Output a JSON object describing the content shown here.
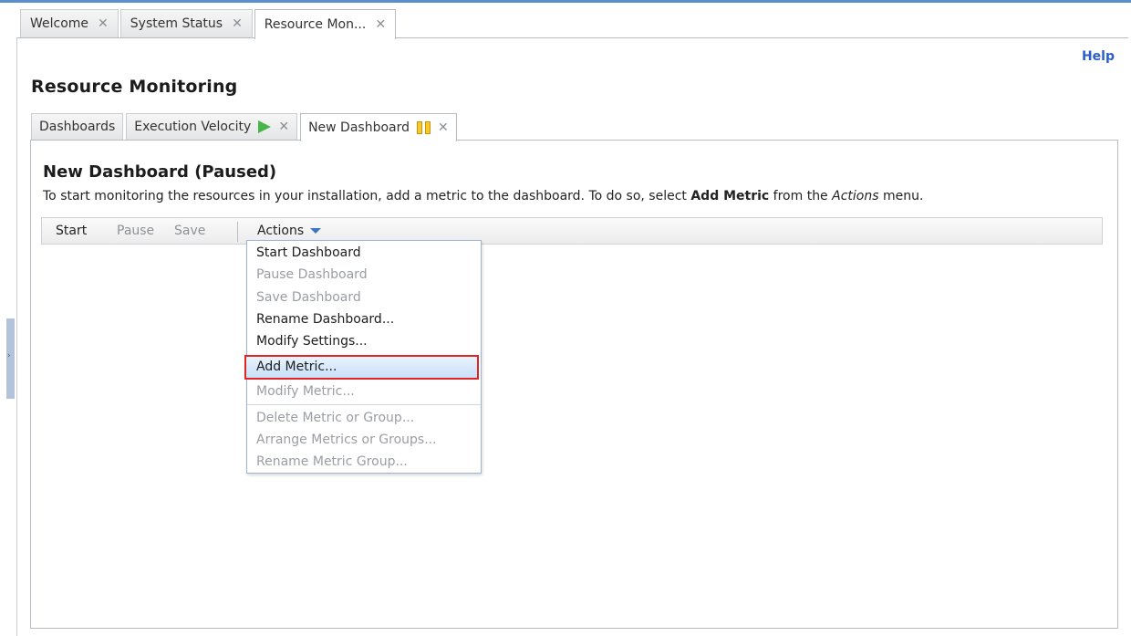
{
  "outer_tabs": [
    {
      "label": "Welcome",
      "active": false
    },
    {
      "label": "System Status",
      "active": false
    },
    {
      "label": "Resource Mon...",
      "active": true
    }
  ],
  "help": "Help",
  "page_title": "Resource Monitoring",
  "inner_tabs": [
    {
      "label": "Dashboards",
      "icon": null,
      "closable": false
    },
    {
      "label": "Execution Velocity",
      "icon": "play-icon",
      "closable": true
    },
    {
      "label": "New Dashboard",
      "icon": "pause-icon",
      "closable": true,
      "active": true
    }
  ],
  "dashboard": {
    "title": "New Dashboard (Paused)",
    "instruction_prefix": "To start monitoring the resources in your installation, add a metric to the dashboard.  To do so, select ",
    "instruction_bold": "Add Metric",
    "instruction_middle": " from the ",
    "instruction_italic": "Actions",
    "instruction_suffix": " menu."
  },
  "toolbar": {
    "start": "Start",
    "pause": "Pause",
    "save": "Save",
    "actions": "Actions"
  },
  "actions_menu": [
    {
      "label": "Start Dashboard",
      "enabled": true
    },
    {
      "label": "Pause Dashboard",
      "enabled": false
    },
    {
      "label": "Save Dashboard",
      "enabled": false
    },
    {
      "label": "Rename Dashboard...",
      "enabled": true
    },
    {
      "label": "Modify Settings...",
      "enabled": true
    },
    {
      "label": "Add Metric...",
      "enabled": true,
      "highlighted": true
    },
    {
      "label": "Modify Metric...",
      "enabled": false
    },
    {
      "label": "Delete Metric or Group...",
      "enabled": false
    },
    {
      "label": "Arrange Metrics or Groups...",
      "enabled": false
    },
    {
      "label": "Rename Metric Group...",
      "enabled": false
    }
  ],
  "colors": {
    "accent": "#5b8fc9",
    "link": "#2a5fc9",
    "highlight_border": "#e02424",
    "play": "#48b548",
    "pause": "#f6c92e"
  }
}
